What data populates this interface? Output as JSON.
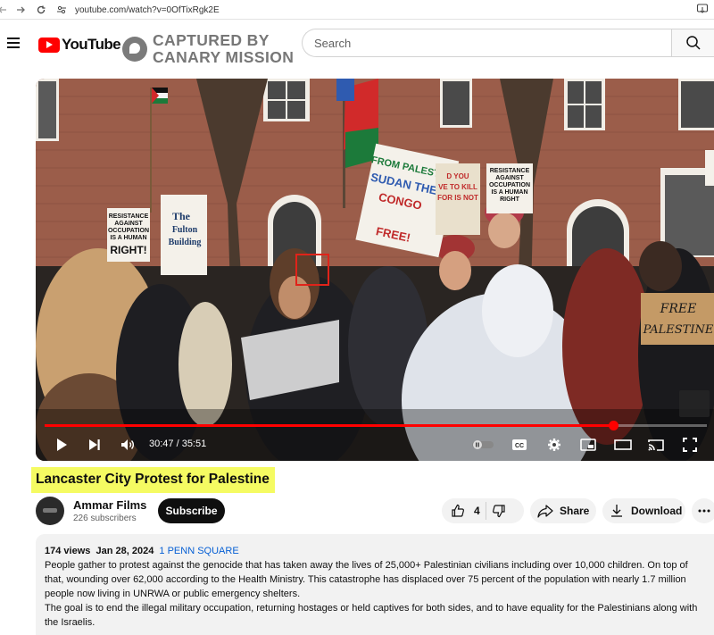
{
  "browser": {
    "url": "youtube.com/watch?v=0OfTixRgk2E"
  },
  "header": {
    "logo_text": "YouTube",
    "watermark_line1": "CAPTURED BY",
    "watermark_line2": "CANARY MISSION",
    "search_placeholder": "Search"
  },
  "player": {
    "current_time": "30:47",
    "duration": "35:51",
    "time_display": "30:47 / 35:51",
    "progress_fraction": 0.8586,
    "sign_texts": [
      "RESISTANCE AGAINST OCCUPATION IS A HUMAN RIGHT!",
      "RESISTANCE AGAINST OCCUPATION IS A HUMAN RIGHT",
      "FREE PALESTINE"
    ]
  },
  "video": {
    "title": "Lancaster City Protest for Palestine",
    "channel_name": "Ammar Films",
    "subscribers": "226 subscribers",
    "subscribe_label": "Subscribe",
    "like_count": "4",
    "share_label": "Share",
    "download_label": "Download"
  },
  "description": {
    "views": "174 views",
    "date": "Jan 28, 2024",
    "location_tag": "1 PENN SQUARE",
    "paragraph1": "People gather to protest against the genocide that has taken away the lives of 25,000+ Palestinian civilians including over 10,000 children. On top of that, wounding over 62,000 according to the Health Ministry. This catastrophe has displaced over 75 percent of the population with nearly 1.7 million people now living in UNRWA or public emergency shelters.",
    "paragraph2": "The goal is to end the illegal military occupation, returning hostages or held captives for both sides, and to have equality for the Palestinians along with the Israelis."
  },
  "colors": {
    "youtube_red": "#ff0000",
    "title_highlight": "#f5fb62",
    "link_blue": "#065fd4",
    "annotation_red": "#e0231a"
  }
}
